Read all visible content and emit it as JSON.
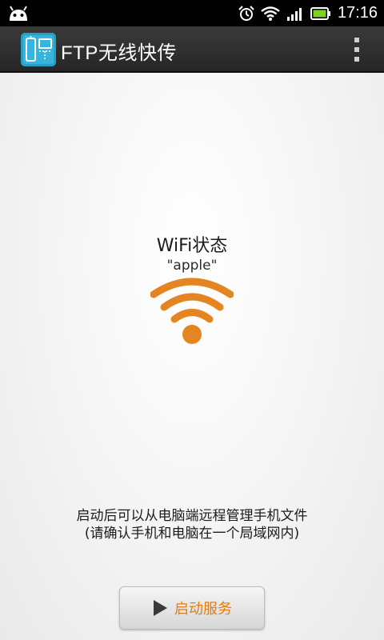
{
  "status_bar": {
    "time": "17:16",
    "icons": [
      "android-icon",
      "alarm-icon",
      "wifi-signal-icon",
      "cell-signal-icon",
      "battery-icon"
    ]
  },
  "app_bar": {
    "title": "FTP无线快传",
    "icon": "ftp-app-icon",
    "menu_icon": "overflow-menu-icon"
  },
  "wifi": {
    "label": "WiFi状态",
    "ssid": "\"apple\"",
    "icon": "wifi-icon",
    "icon_color": "#e58521"
  },
  "hint": {
    "line1": "启动后可以从电脑端远程管理手机文件",
    "line2": "(请确认手机和电脑在一个局域网内)"
  },
  "start_button": {
    "label": "启动服务",
    "icon": "play-icon",
    "label_color": "#e07d10"
  }
}
